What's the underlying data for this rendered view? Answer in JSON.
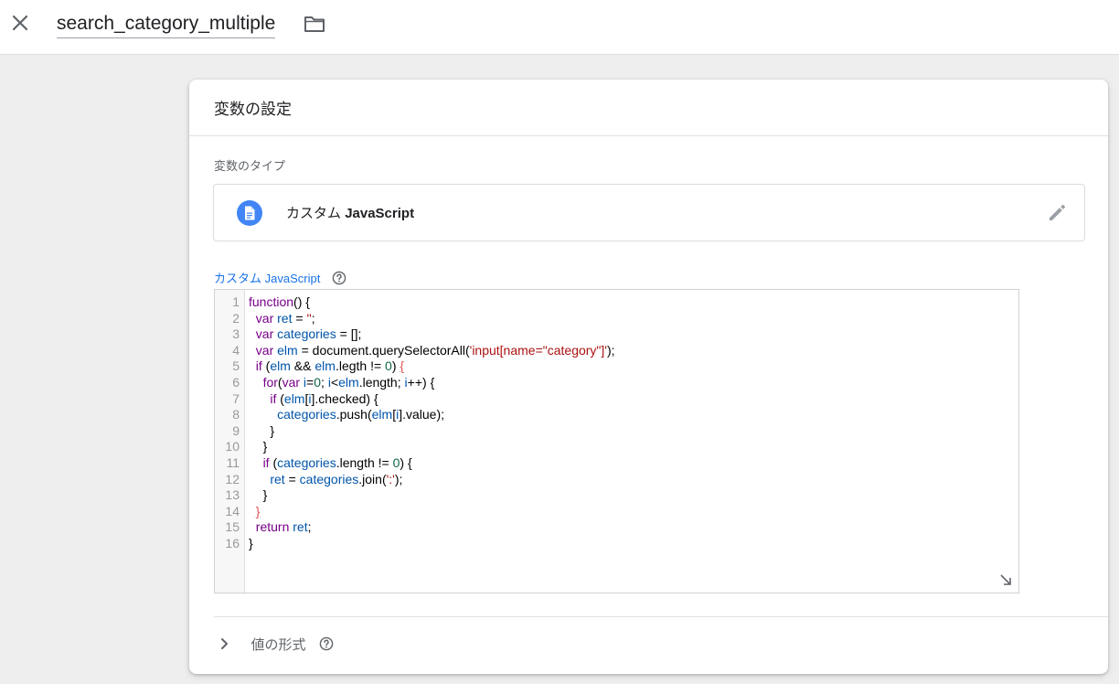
{
  "topbar": {
    "title_value": "search_category_multiple",
    "close_icon": "close-icon",
    "folder_icon": "folder-icon"
  },
  "card": {
    "title": "変数の設定",
    "type_section_label": "変数のタイプ",
    "type": {
      "name_prefix": "カスタム",
      "name_bold": "JavaScript",
      "icon": "document-icon",
      "edit_icon": "pencil-icon"
    },
    "code_label": "カスタム JavaScript",
    "code_lines": [
      "function() {",
      "  var ret = '';",
      "  var categories = [];",
      "  var elm = document.querySelectorAll('input[name=\"category\"]');",
      "  if (elm && elm.legth != 0) {",
      "    for(var i=0; i<elm.length; i++) {",
      "      if (elm[i].checked) {",
      "        categories.push(elm[i].value);",
      "      }",
      "    }",
      "    if (categories.length != 0) {",
      "      ret = categories.join(':');",
      "    }",
      "  }",
      "  return ret;",
      "}"
    ],
    "format_label": "値の形式"
  },
  "colors": {
    "accent": "#1a73e8",
    "icon_blue": "#4285f4",
    "keyword": "#770088",
    "variable": "#0055aa",
    "string": "#aa1111",
    "number": "#116644"
  }
}
